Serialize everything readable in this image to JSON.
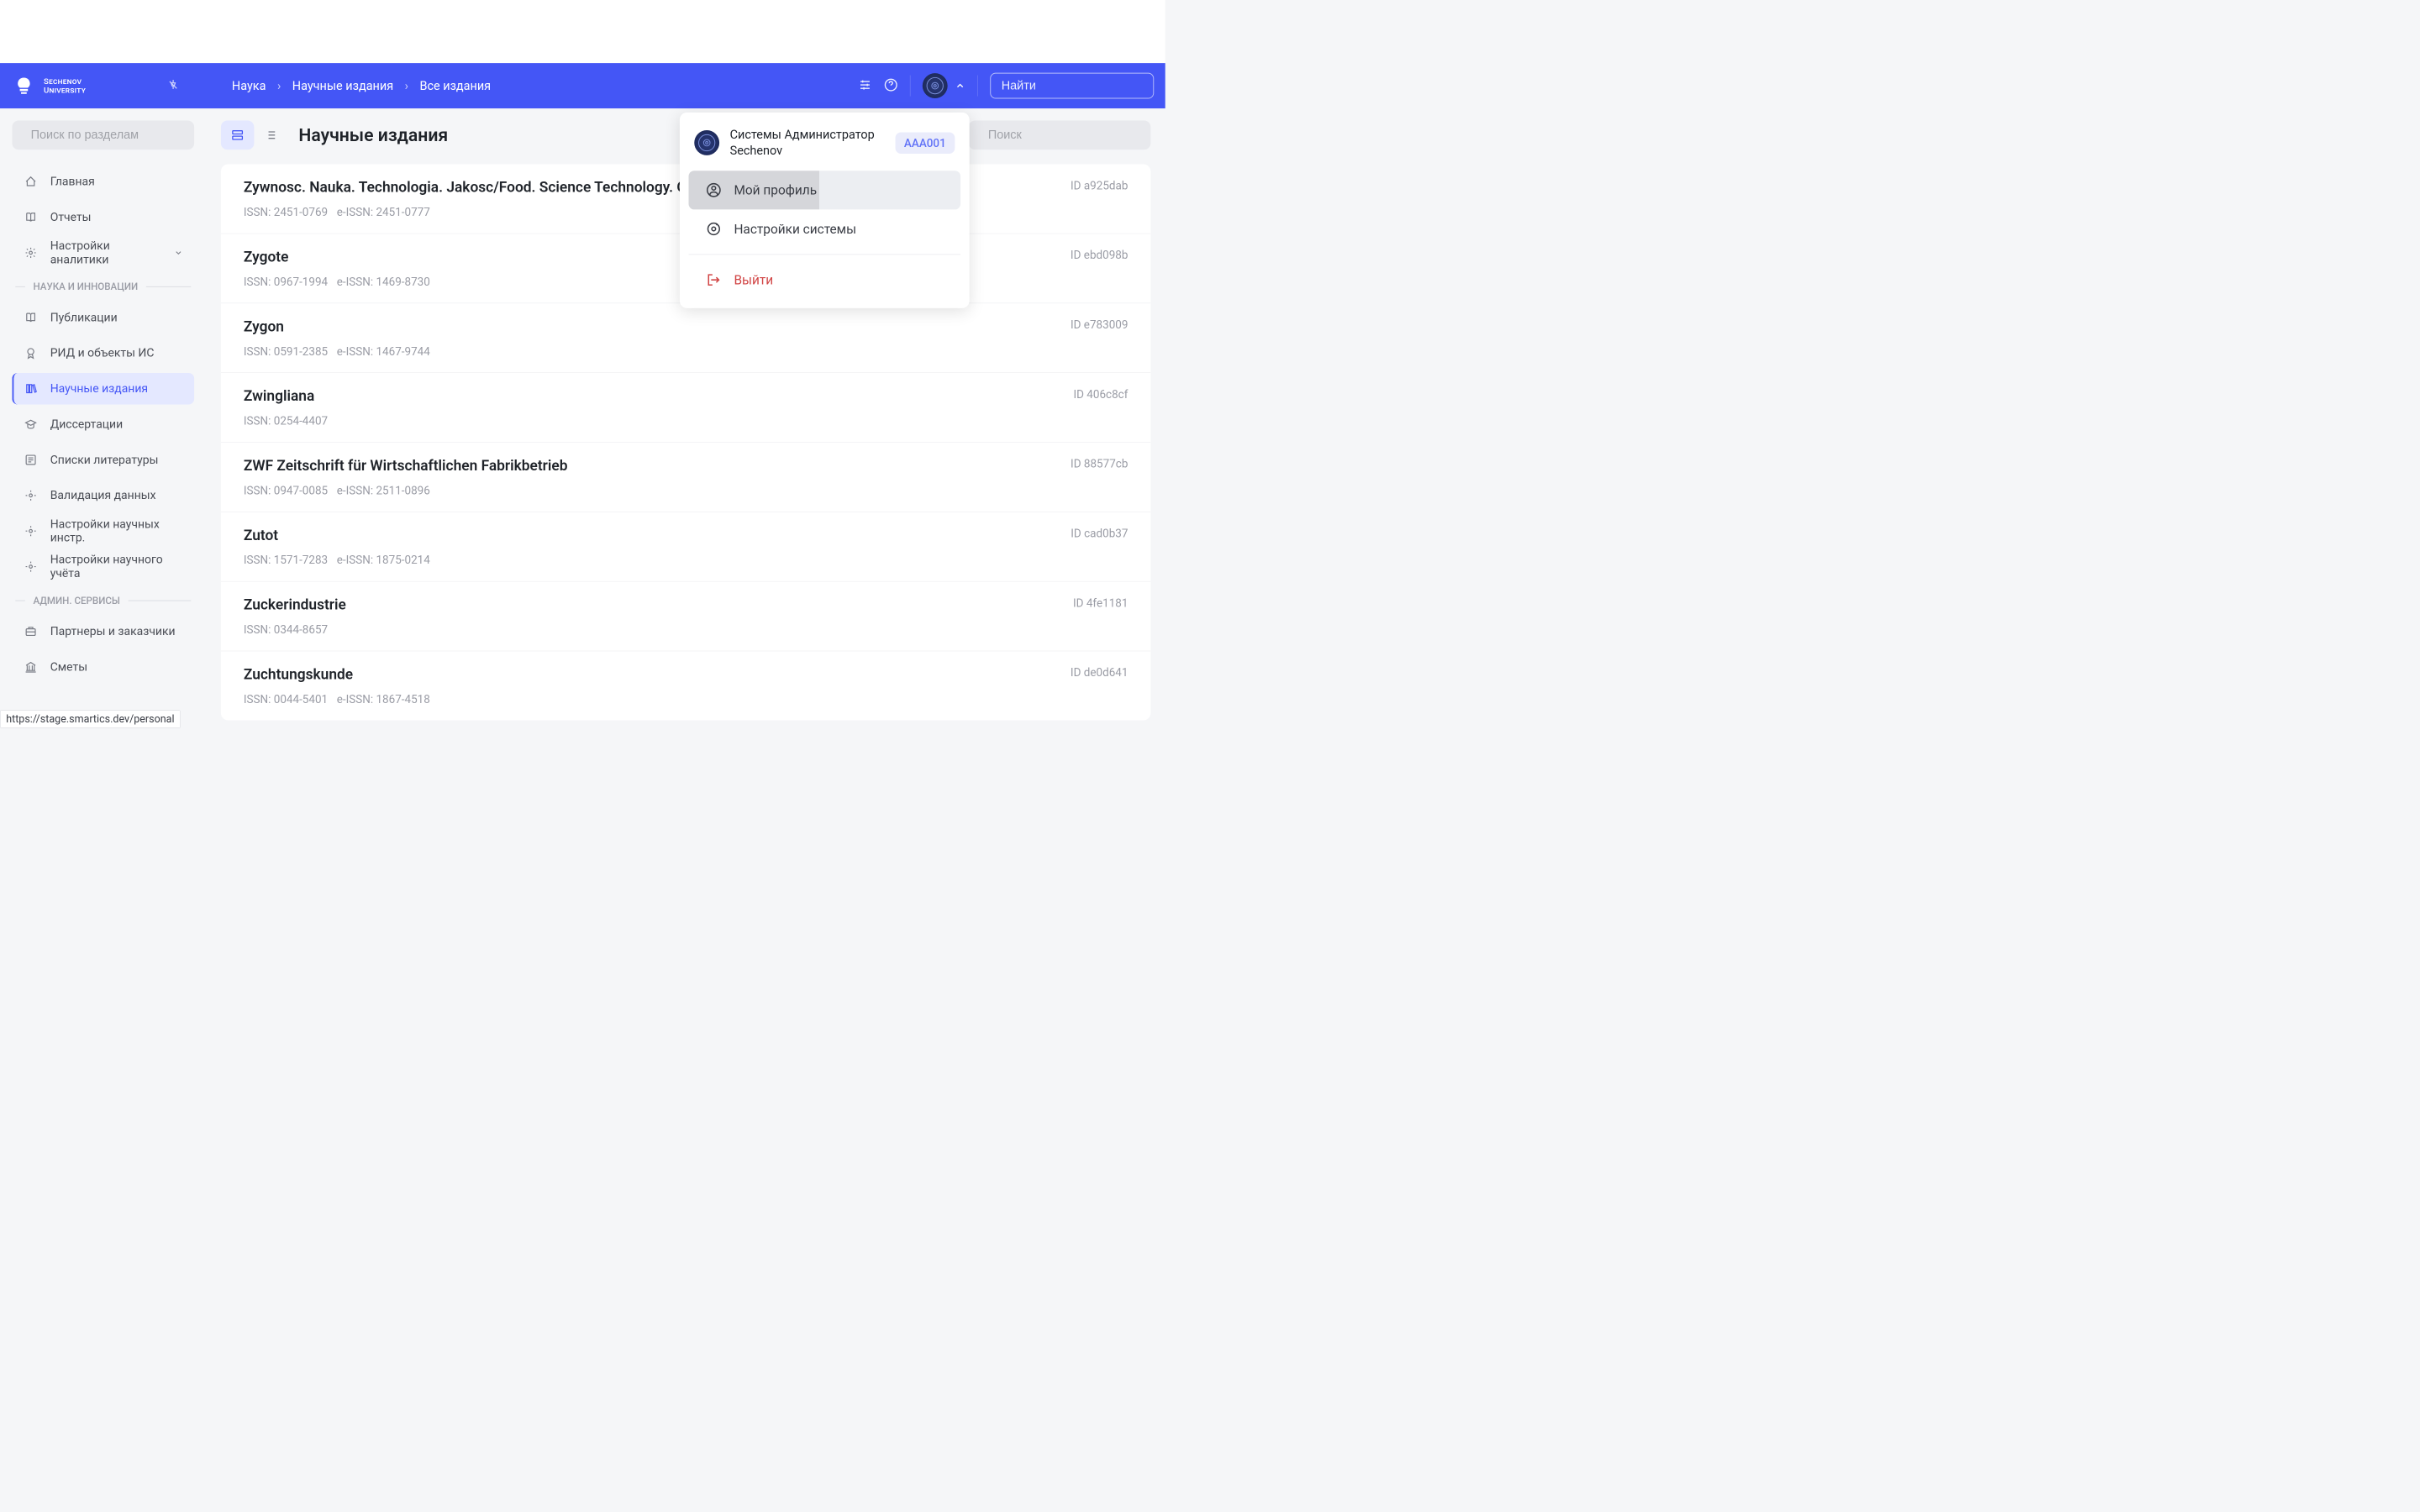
{
  "header": {
    "logo": "Sechenov University",
    "breadcrumbs": [
      "Наука",
      "Научные издания",
      "Все издания"
    ],
    "search_placeholder": "Найти"
  },
  "sidebar": {
    "search_placeholder": "Поиск по разделам",
    "items_top": [
      {
        "icon": "home",
        "label": "Главная"
      },
      {
        "icon": "book",
        "label": "Отчеты"
      },
      {
        "icon": "gear",
        "label": "Настройки аналитики",
        "expandable": true
      }
    ],
    "section1_label": "НАУКА И ИННОВАЦИИ",
    "items_science": [
      {
        "icon": "doc",
        "label": "Публикации"
      },
      {
        "icon": "award",
        "label": "РИД и объекты ИС"
      },
      {
        "icon": "books",
        "label": "Научные издания",
        "active": true
      },
      {
        "icon": "grad",
        "label": "Диссертации"
      },
      {
        "icon": "list",
        "label": "Списки литературы"
      },
      {
        "icon": "check",
        "label": "Валидация данных"
      },
      {
        "icon": "gear",
        "label": "Настройки научных инстр."
      },
      {
        "icon": "gear",
        "label": "Настройки научного учёта"
      }
    ],
    "section2_label": "АДМИН. СЕРВИСЫ",
    "items_admin": [
      {
        "icon": "briefcase",
        "label": "Партнеры и заказчики"
      },
      {
        "icon": "bank",
        "label": "Сметы"
      }
    ]
  },
  "main": {
    "title": "Научные издания",
    "search_placeholder": "Поиск",
    "publications": [
      {
        "title": "Zywnosc. Nauka. Technologia. Jakosc/Food. Science Technology. Qua...",
        "issn": "2451-0769",
        "eissn": "2451-0777",
        "id": "a925dab"
      },
      {
        "title": "Zygote",
        "issn": "0967-1994",
        "eissn": "1469-8730",
        "id": "ebd098b"
      },
      {
        "title": "Zygon",
        "issn": "0591-2385",
        "eissn": "1467-9744",
        "id": "e783009"
      },
      {
        "title": "Zwingliana",
        "issn": "0254-4407",
        "eissn": "",
        "id": "406c8cf"
      },
      {
        "title": "ZWF Zeitschrift für Wirtschaftlichen Fabrikbetrieb",
        "issn": "0947-0085",
        "eissn": "2511-0896",
        "id": "88577cb"
      },
      {
        "title": "Zutot",
        "issn": "1571-7283",
        "eissn": "1875-0214",
        "id": "cad0b37"
      },
      {
        "title": "Zuckerindustrie",
        "issn": "0344-8657",
        "eissn": "",
        "id": "4fe1181"
      },
      {
        "title": "Zuchtungskunde",
        "issn": "0044-5401",
        "eissn": "1867-4518",
        "id": "de0d641"
      }
    ],
    "issn_label": "ISSN:",
    "eissn_label": "e-ISSN:",
    "id_label": "ID"
  },
  "dropdown": {
    "user_name": "Системы Администратор Sechenov",
    "badge": "AAA001",
    "profile": "Мой профиль",
    "settings": "Настройки системы",
    "logout": "Выйти"
  },
  "status": "https://stage.smartics.dev/personal"
}
